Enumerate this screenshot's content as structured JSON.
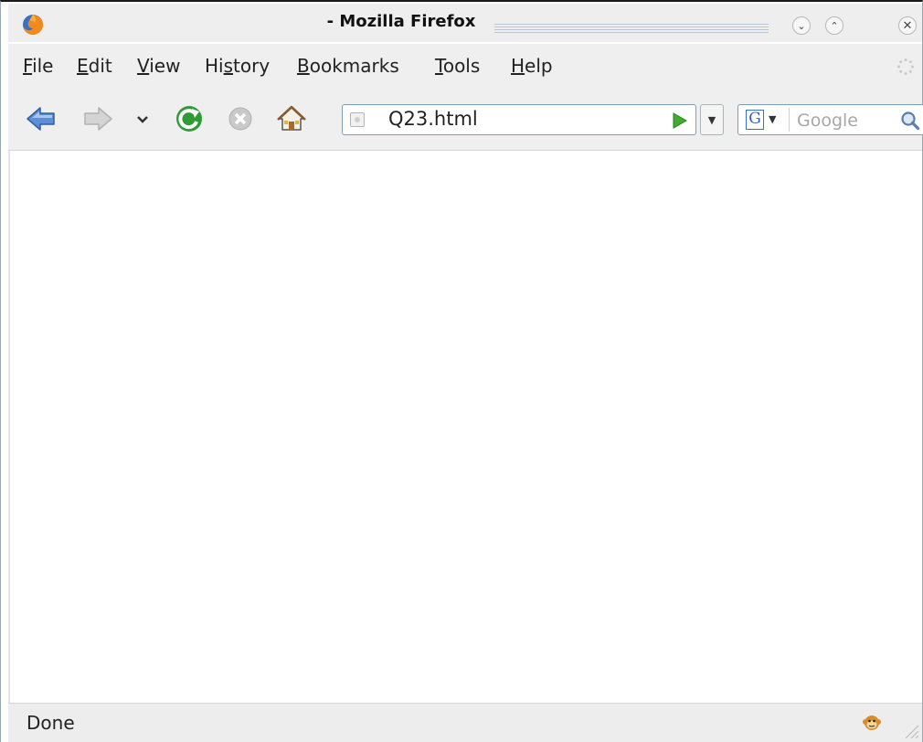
{
  "window": {
    "title": "- Mozilla Firefox"
  },
  "menu": [
    "File",
    "Edit",
    "View",
    "History",
    "Bookmarks",
    "Tools",
    "Help"
  ],
  "menu_mnemonics": [
    "F",
    "E",
    "V",
    "s",
    "B",
    "T",
    "H"
  ],
  "address_bar": {
    "value": "Q23.html"
  },
  "search": {
    "engine": "G",
    "placeholder": "Google"
  },
  "status": {
    "text": "Done"
  },
  "icons": [
    "firefox-logo-icon",
    "minimize-icon",
    "maximize-icon",
    "close-icon",
    "back-arrow-icon",
    "forward-arrow-icon",
    "history-dropdown-icon",
    "reload-icon",
    "stop-icon",
    "home-icon",
    "site-identity-icon",
    "go-icon",
    "search-icon",
    "throbber-icon",
    "security-monkey-icon",
    "resize-grip-icon"
  ],
  "colors": {
    "title_bar": "#eeeeee",
    "toolbar": "#efefef",
    "accent_blue": "#3a6fd0",
    "reload_green": "#2e9b35",
    "go_green": "#3fae2e"
  }
}
